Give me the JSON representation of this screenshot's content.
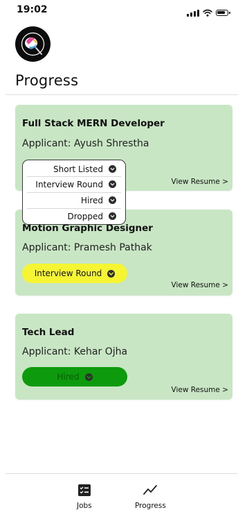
{
  "status_bar": {
    "time": "19:02",
    "icons": [
      "signal-icon",
      "wifi-icon",
      "battery-icon"
    ]
  },
  "header": {
    "logo": "app-logo",
    "title": "Progress"
  },
  "colors": {
    "card_bg": "#c8e6c4",
    "pill_interview": "#f5f534",
    "pill_hired": "#0d9a0d",
    "dark": "#2e2e2e"
  },
  "cards": [
    {
      "job_title": "Full Stack MERN Developer",
      "applicant": "Applicant: Ayush Shrestha",
      "view_resume": "View Resume >"
    },
    {
      "job_title": "Motion Graphic Designer",
      "applicant": "Applicant: Pramesh Pathak",
      "status": "Interview Round",
      "view_resume": "View Resume >"
    },
    {
      "job_title": "Tech Lead",
      "applicant": "Applicant: Kehar Ojha",
      "status": "Hired",
      "view_resume": "View Resume >"
    }
  ],
  "status_dropdown": {
    "options": [
      "Short Listed",
      "Interview Round",
      "Hired",
      "Dropped"
    ]
  },
  "bottom_nav": {
    "items": [
      {
        "label": "Jobs",
        "icon": "jobs-checklist-icon"
      },
      {
        "label": "Progress",
        "icon": "trend-line-icon"
      }
    ]
  }
}
